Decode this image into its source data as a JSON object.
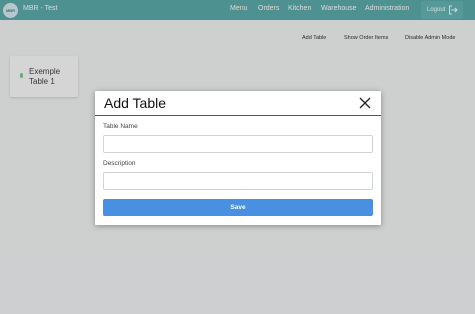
{
  "header": {
    "brand_badge": "MBR",
    "app_title": "MBR - Test",
    "nav": [
      "Menu",
      "Orders",
      "Kitchen",
      "Warehouse",
      "Administration"
    ],
    "logout_label": "Logout"
  },
  "actions": [
    "Add Table",
    "Show Order Items",
    "Disable Admin Mode"
  ],
  "tables": [
    {
      "name": "Exemple Table 1"
    }
  ],
  "modal": {
    "title": "Add Table",
    "fields": [
      {
        "label": "Table Name",
        "value": "",
        "placeholder": ""
      },
      {
        "label": "Description",
        "value": "",
        "placeholder": ""
      }
    ],
    "save_label": "Save"
  },
  "colors": {
    "header": "#5aa9a8",
    "primary": "#4a90e2",
    "status_dot": "#7fc98a"
  }
}
